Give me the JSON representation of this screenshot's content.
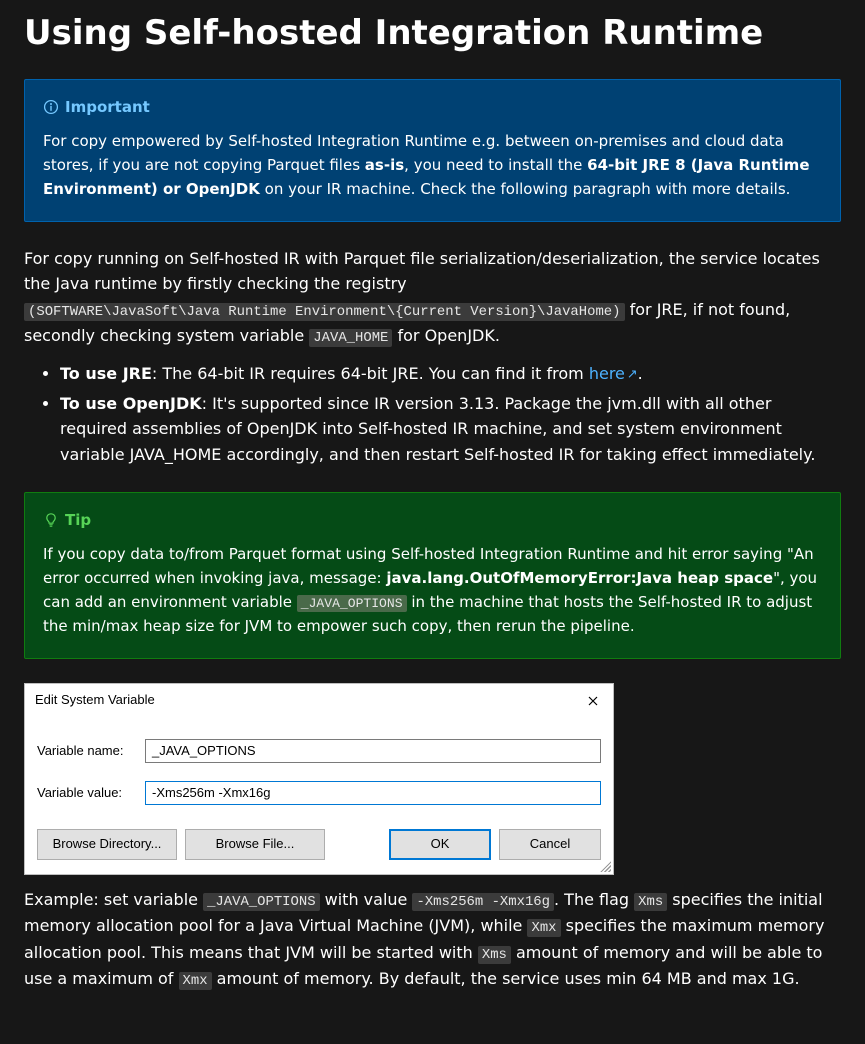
{
  "heading": "Using Self-hosted Integration Runtime",
  "important": {
    "title": "Important",
    "text_pre": "For copy empowered by Self-hosted Integration Runtime e.g. between on-premises and cloud data stores, if you are not copying Parquet files ",
    "bold1": "as-is",
    "mid1": ", you need to install the ",
    "bold2": "64-bit JRE 8 (Java Runtime Environment) or OpenJDK",
    "text_post": " on your IR machine. Check the following paragraph with more details."
  },
  "para1": {
    "pre": "For copy running on Self-hosted IR with Parquet file serialization/deserialization, the service locates the Java runtime by firstly checking the registry ",
    "code1": "(SOFTWARE\\JavaSoft\\Java Runtime Environment\\{Current Version}\\JavaHome)",
    "mid": " for JRE, if not found, secondly checking system variable ",
    "code2": "JAVA_HOME",
    "post": " for OpenJDK."
  },
  "list": {
    "jre": {
      "bold": "To use JRE",
      "text": ": The 64-bit IR requires 64-bit JRE. You can find it from ",
      "link": "here",
      "after": "."
    },
    "openjdk": {
      "bold": "To use OpenJDK",
      "text": ": It's supported since IR version 3.13. Package the jvm.dll with all other required assemblies of OpenJDK into Self-hosted IR machine, and set system environment variable JAVA_HOME accordingly, and then restart Self-hosted IR for taking effect immediately."
    }
  },
  "tip": {
    "title": "Tip",
    "pre": "If you copy data to/from Parquet format using Self-hosted Integration Runtime and hit error saying \"An error occurred when invoking java, message: ",
    "bold": "java.lang.OutOfMemoryError:Java heap space",
    "mid": "\", you can add an environment variable ",
    "code": "_JAVA_OPTIONS",
    "post": " in the machine that hosts the Self-hosted IR to adjust the min/max heap size for JVM to empower such copy, then rerun the pipeline."
  },
  "dialog": {
    "title": "Edit System Variable",
    "name_label": "Variable name:",
    "name_value": "_JAVA_OPTIONS",
    "value_label": "Variable value:",
    "value_value": "-Xms256m -Xmx16g",
    "browse_dir": "Browse Directory...",
    "browse_file": "Browse File...",
    "ok": "OK",
    "cancel": "Cancel"
  },
  "para2": {
    "pre": "Example: set variable ",
    "code1": "_JAVA_OPTIONS",
    "mid1": " with value ",
    "code2": "-Xms256m -Xmx16g",
    "mid2": ". The flag ",
    "code3": "Xms",
    "mid3": " specifies the initial memory allocation pool for a Java Virtual Machine (JVM), while ",
    "code4": "Xmx",
    "mid4": " specifies the maximum memory allocation pool. This means that JVM will be started with ",
    "code5": "Xms",
    "mid5": " amount of memory and will be able to use a maximum of ",
    "code6": "Xmx",
    "post": " amount of memory. By default, the service uses min 64 MB and max 1G."
  }
}
